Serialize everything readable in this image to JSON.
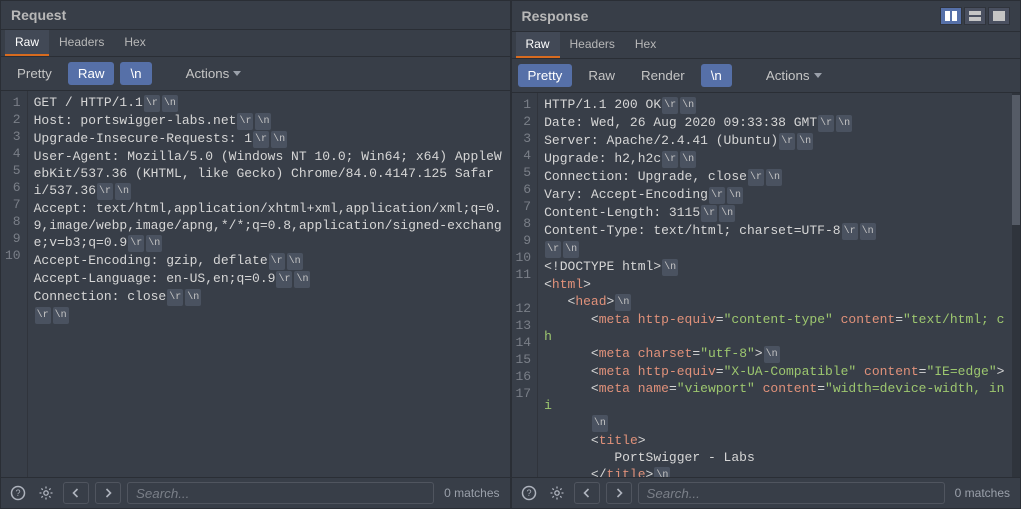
{
  "request": {
    "title": "Request",
    "tabs": [
      "Raw",
      "Headers",
      "Hex"
    ],
    "active_tab": "Raw",
    "toolbar": {
      "pretty": "Pretty",
      "raw": "Raw",
      "newline": "\\n",
      "actions": "Actions"
    },
    "lines": [
      {
        "n": "1",
        "segs": [
          {
            "t": "GET / HTTP/1.1"
          },
          {
            "cr": true
          },
          {
            "lf": true
          }
        ]
      },
      {
        "n": "2",
        "segs": [
          {
            "t": "Host: portswigger-labs.net"
          },
          {
            "cr": true
          },
          {
            "lf": true
          }
        ]
      },
      {
        "n": "3",
        "segs": [
          {
            "t": "Upgrade-Insecure-Requests: 1"
          },
          {
            "cr": true
          },
          {
            "lf": true
          }
        ]
      },
      {
        "n": "4",
        "segs": [
          {
            "t": "User-Agent: Mozilla/5.0 (Windows NT 10.0; Win64; x64) AppleWebKit/537.36 (KHTML, like Gecko) Chrome/84.0.4147.125 Safari/537.36"
          },
          {
            "cr": true
          },
          {
            "lf": true
          }
        ]
      },
      {
        "n": "5",
        "segs": [
          {
            "t": "Accept: text/html,application/xhtml+xml,application/xml;q=0.9,image/webp,image/apng,*/*;q=0.8,application/signed-exchange;v=b3;q=0.9"
          },
          {
            "cr": true
          },
          {
            "lf": true
          }
        ]
      },
      {
        "n": "6",
        "segs": [
          {
            "t": "Accept-Encoding: gzip, deflate"
          },
          {
            "cr": true
          },
          {
            "lf": true
          }
        ]
      },
      {
        "n": "7",
        "segs": [
          {
            "t": "Accept-Language: en-US,en;q=0.9"
          },
          {
            "cr": true
          },
          {
            "lf": true
          }
        ]
      },
      {
        "n": "8",
        "segs": [
          {
            "t": "Connection: close"
          },
          {
            "cr": true
          },
          {
            "lf": true
          }
        ]
      },
      {
        "n": "9",
        "segs": [
          {
            "cr": true
          },
          {
            "lf": true
          }
        ]
      },
      {
        "n": "10",
        "segs": []
      }
    ],
    "search": {
      "placeholder": "Search...",
      "matches": "0 matches"
    }
  },
  "response": {
    "title": "Response",
    "tabs": [
      "Raw",
      "Headers",
      "Hex"
    ],
    "active_tab": "Raw",
    "toolbar": {
      "pretty": "Pretty",
      "raw": "Raw",
      "render": "Render",
      "newline": "\\n",
      "actions": "Actions"
    },
    "lines": [
      {
        "n": "1",
        "segs": [
          {
            "t": "HTTP/1.1 200 OK"
          },
          {
            "cr": true
          },
          {
            "lf": true
          }
        ]
      },
      {
        "n": "2",
        "segs": [
          {
            "t": "Date: Wed, 26 Aug 2020 09:33:38 GMT"
          },
          {
            "cr": true
          },
          {
            "lf": true
          }
        ]
      },
      {
        "n": "3",
        "segs": [
          {
            "t": "Server: Apache/2.4.41 (Ubuntu)"
          },
          {
            "cr": true
          },
          {
            "lf": true
          }
        ]
      },
      {
        "n": "4",
        "segs": [
          {
            "t": "Upgrade: h2,h2c"
          },
          {
            "cr": true
          },
          {
            "lf": true
          }
        ]
      },
      {
        "n": "5",
        "segs": [
          {
            "t": "Connection: Upgrade, close"
          },
          {
            "cr": true
          },
          {
            "lf": true
          }
        ]
      },
      {
        "n": "6",
        "segs": [
          {
            "t": "Vary: Accept-Encoding"
          },
          {
            "cr": true
          },
          {
            "lf": true
          }
        ]
      },
      {
        "n": "7",
        "segs": [
          {
            "t": "Content-Length: 3115"
          },
          {
            "cr": true
          },
          {
            "lf": true
          }
        ]
      },
      {
        "n": "8",
        "segs": [
          {
            "t": "Content-Type: text/html; charset=UTF-8"
          },
          {
            "cr": true
          },
          {
            "lf": true
          }
        ]
      },
      {
        "n": "9",
        "segs": [
          {
            "cr": true
          },
          {
            "lf": true
          }
        ]
      },
      {
        "n": "10",
        "segs": [
          {
            "t": "<!DOCTYPE html>",
            "cls": "punc"
          },
          {
            "lf": true
          }
        ]
      },
      {
        "n": "11",
        "segs": [
          {
            "t": "<",
            "cls": "punc"
          },
          {
            "t": "html",
            "cls": "tag"
          },
          {
            "t": ">",
            "cls": "punc"
          }
        ]
      },
      {
        "n": "",
        "segs": [
          {
            "t": "   "
          },
          {
            "t": "<",
            "cls": "punc"
          },
          {
            "t": "head",
            "cls": "tag"
          },
          {
            "t": ">",
            "cls": "punc"
          },
          {
            "lf": true
          }
        ]
      },
      {
        "n": "12",
        "segs": [
          {
            "t": "      "
          },
          {
            "t": "<",
            "cls": "punc"
          },
          {
            "t": "meta",
            "cls": "tag"
          },
          {
            "t": " http-equiv",
            "cls": "attr"
          },
          {
            "t": "=",
            "cls": "punc"
          },
          {
            "t": "\"content-type\"",
            "cls": "val"
          },
          {
            "t": " content",
            "cls": "attr"
          },
          {
            "t": "=",
            "cls": "punc"
          },
          {
            "t": "\"text/html; ch",
            "cls": "val"
          }
        ]
      },
      {
        "n": "13",
        "segs": [
          {
            "t": "      "
          },
          {
            "t": "<",
            "cls": "punc"
          },
          {
            "t": "meta",
            "cls": "tag"
          },
          {
            "t": " charset",
            "cls": "attr"
          },
          {
            "t": "=",
            "cls": "punc"
          },
          {
            "t": "\"utf-8\"",
            "cls": "val"
          },
          {
            "t": ">",
            "cls": "punc"
          },
          {
            "lf": true
          }
        ]
      },
      {
        "n": "14",
        "segs": [
          {
            "t": "      "
          },
          {
            "t": "<",
            "cls": "punc"
          },
          {
            "t": "meta",
            "cls": "tag"
          },
          {
            "t": " http-equiv",
            "cls": "attr"
          },
          {
            "t": "=",
            "cls": "punc"
          },
          {
            "t": "\"X-UA-Compatible\"",
            "cls": "val"
          },
          {
            "t": " content",
            "cls": "attr"
          },
          {
            "t": "=",
            "cls": "punc"
          },
          {
            "t": "\"IE=edge\"",
            "cls": "val"
          },
          {
            "t": ">",
            "cls": "punc"
          }
        ]
      },
      {
        "n": "15",
        "segs": [
          {
            "t": "      "
          },
          {
            "t": "<",
            "cls": "punc"
          },
          {
            "t": "meta",
            "cls": "tag"
          },
          {
            "t": " name",
            "cls": "attr"
          },
          {
            "t": "=",
            "cls": "punc"
          },
          {
            "t": "\"viewport\"",
            "cls": "val"
          },
          {
            "t": " content",
            "cls": "attr"
          },
          {
            "t": "=",
            "cls": "punc"
          },
          {
            "t": "\"width=device-width, ini",
            "cls": "val"
          }
        ]
      },
      {
        "n": "16",
        "segs": [
          {
            "t": "      "
          },
          {
            "lf": true
          }
        ]
      },
      {
        "n": "17",
        "segs": [
          {
            "t": "      "
          },
          {
            "t": "<",
            "cls": "punc"
          },
          {
            "t": "title",
            "cls": "tag"
          },
          {
            "t": ">",
            "cls": "punc"
          }
        ]
      },
      {
        "n": "",
        "segs": [
          {
            "t": "         PortSwigger - Labs"
          }
        ]
      },
      {
        "n": "",
        "segs": [
          {
            "t": "      "
          },
          {
            "t": "</",
            "cls": "punc"
          },
          {
            "t": "title",
            "cls": "tag"
          },
          {
            "t": ">",
            "cls": "punc"
          },
          {
            "lf": true
          }
        ]
      }
    ],
    "search": {
      "placeholder": "Search...",
      "matches": "0 matches"
    }
  }
}
